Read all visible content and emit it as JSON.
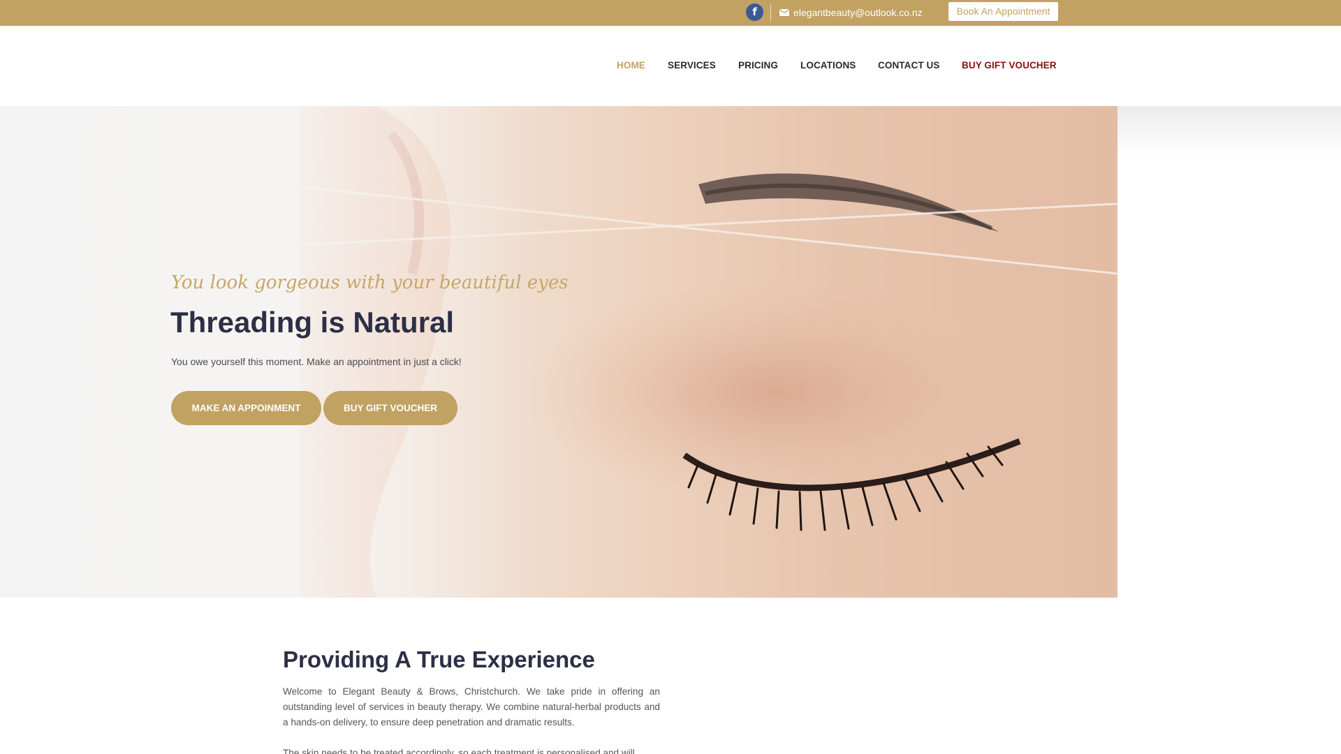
{
  "topbar": {
    "facebook_icon": "facebook-icon",
    "email": "elegantbeauty@outlook.co.nz",
    "email_icon": "envelope-icon",
    "book_button": "Book An Appointment"
  },
  "nav": {
    "items": [
      {
        "label": "HOME",
        "state": "active"
      },
      {
        "label": "SERVICES"
      },
      {
        "label": "PRICING"
      },
      {
        "label": "LOCATIONS"
      },
      {
        "label": "CONTACT US"
      },
      {
        "label": "BUY GIFT VOUCHER",
        "state": "highlight"
      }
    ]
  },
  "hero": {
    "tagline": "You look gorgeous with your beautiful eyes",
    "title": "Threading is Natural",
    "subtitle": "You owe yourself this moment. Make an appointment in just a click!",
    "button_appointment": "MAKE AN APPOINMENT",
    "button_voucher": "BUY GIFT VOUCHER"
  },
  "about": {
    "title": "Providing A True Experience",
    "body": "Welcome to Elegant Beauty & Brows, Christchurch. We take pride in offering an outstanding level of services in beauty therapy. We combine natural-herbal products and a hands-on delivery, to ensure deep penetration and dramatic results.",
    "body_next": "The skin needs to be treated accordingly, so each treatment is personalised and will"
  },
  "colors": {
    "accent_gold": "#c1a262",
    "voucher_red": "#8b0f0f",
    "heading_navy": "#2c2f45",
    "facebook_blue": "#3b5998"
  }
}
